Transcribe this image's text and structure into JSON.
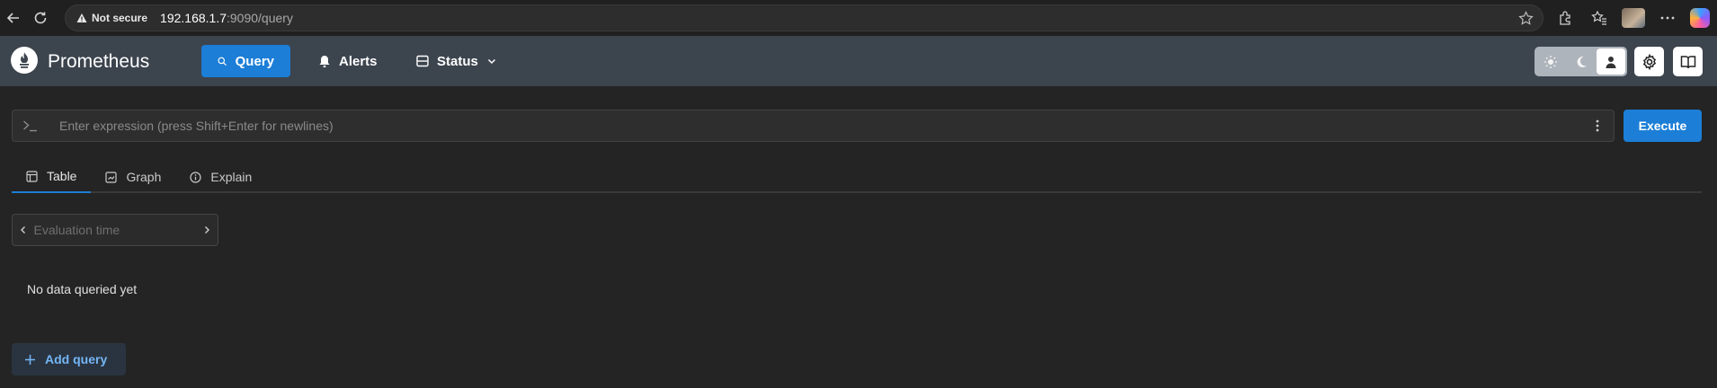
{
  "browser": {
    "security_label": "Not secure",
    "url_host": "192.168.1.7",
    "url_path": ":9090/query"
  },
  "header": {
    "brand": "Prometheus",
    "nav": {
      "query": "Query",
      "alerts": "Alerts",
      "status": "Status"
    },
    "theme_active": "auto"
  },
  "query": {
    "expression_placeholder": "Enter expression (press Shift+Enter for newlines)",
    "execute_label": "Execute",
    "tabs": {
      "table": "Table",
      "graph": "Graph",
      "explain": "Explain"
    },
    "active_tab": "table",
    "eval_time_placeholder": "Evaluation time",
    "empty_message": "No data queried yet",
    "add_query_label": "Add query"
  },
  "colors": {
    "accent": "#1c7ed6",
    "header_bg": "#3c444e",
    "page_bg": "#242424"
  }
}
